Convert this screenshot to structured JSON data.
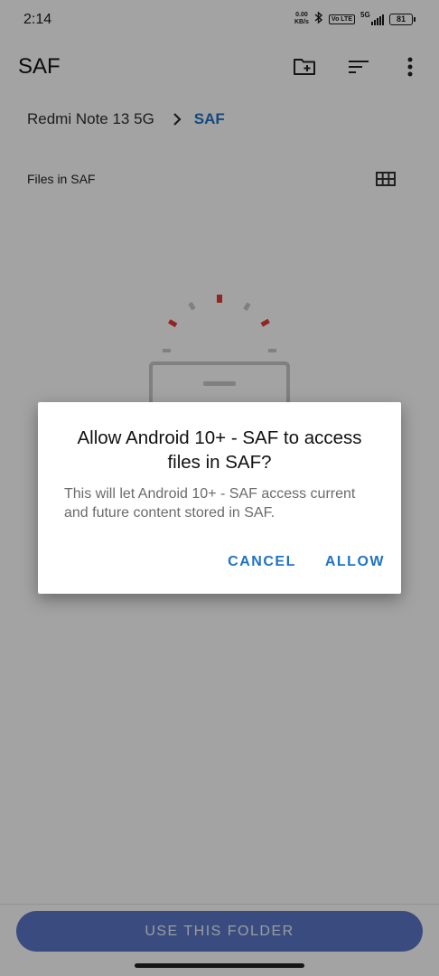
{
  "status_bar": {
    "time": "2:14",
    "net_speed_value": "0.00",
    "net_speed_unit": "KB/s",
    "bluetooth_icon": "bluetooth-icon",
    "volte_label": "Vo LTE",
    "network_label": "5G",
    "battery_level": "81"
  },
  "app_bar": {
    "title": "SAF",
    "actions": [
      "new-folder-icon",
      "sort-icon",
      "more-vert-icon"
    ]
  },
  "breadcrumb": {
    "root": "Redmi Note 13 5G",
    "current": "SAF"
  },
  "content": {
    "section_label": "Files in SAF",
    "view_toggle_icon": "grid-view-icon"
  },
  "bottom_button": {
    "label": "USE THIS FOLDER"
  },
  "dialog": {
    "title": "Allow Android 10+ - SAF to access files in SAF?",
    "message": "This will let Android 10+ - SAF access current and future content stored in SAF.",
    "cancel_label": "CANCEL",
    "allow_label": "ALLOW"
  },
  "colors": {
    "accent": "#1f73c2",
    "primary_button": "#5b78c7",
    "illustration_red": "#e53935",
    "illustration_gray": "#c8c8c8"
  }
}
